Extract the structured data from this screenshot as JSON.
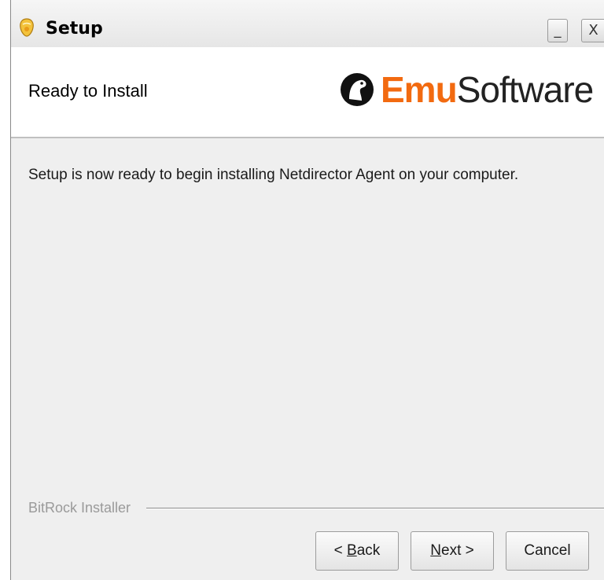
{
  "window": {
    "title": "Setup",
    "icon": "bitrock-installer-icon",
    "minimize_label": "_",
    "close_label": "X"
  },
  "header": {
    "page_title": "Ready to Install",
    "logo": {
      "part1": "Emu",
      "part2": "Software",
      "mark": "emu-head-logo-icon",
      "accent_color": "#f26a10"
    }
  },
  "body": {
    "message": "Setup is now ready to begin installing Netdirector Agent on your computer."
  },
  "footer": {
    "installer_label": "BitRock Installer",
    "buttons": {
      "back": {
        "prefix": "< ",
        "mnemonic": "B",
        "rest": "ack"
      },
      "next": {
        "mnemonic": "N",
        "rest": "ext >"
      },
      "cancel": "Cancel"
    }
  }
}
